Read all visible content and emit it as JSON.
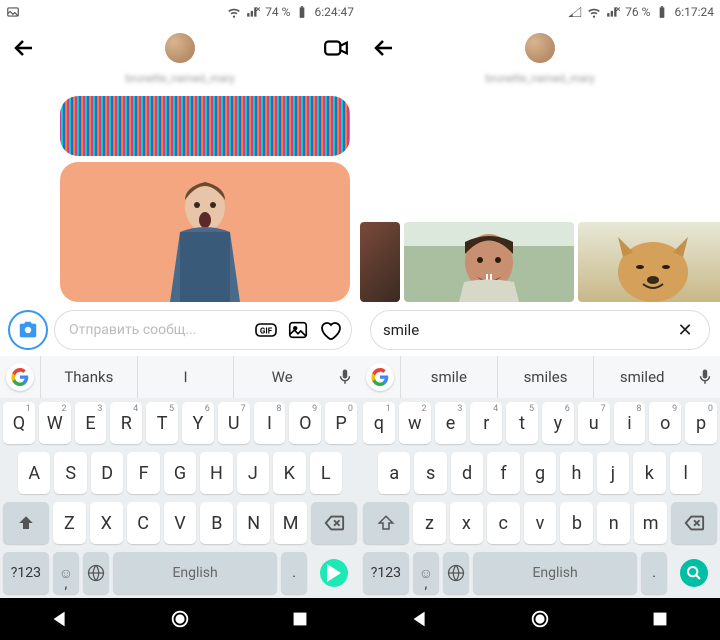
{
  "left": {
    "status": {
      "battery": "74 %",
      "time": "6:24:47"
    },
    "username": "brunette_named_mary",
    "composer": {
      "placeholder": "Отправить сообщ..."
    },
    "suggestions": [
      "Thanks",
      "I",
      "We"
    ],
    "keyboard": {
      "row1": [
        "Q",
        "W",
        "E",
        "R",
        "T",
        "Y",
        "U",
        "I",
        "O",
        "P"
      ],
      "sup1": [
        "1",
        "2",
        "3",
        "4",
        "5",
        "6",
        "7",
        "8",
        "9",
        "0"
      ],
      "row2": [
        "A",
        "S",
        "D",
        "F",
        "G",
        "H",
        "J",
        "K",
        "L"
      ],
      "row3": [
        "Z",
        "X",
        "C",
        "V",
        "B",
        "N",
        "M"
      ],
      "numkey": "?123",
      "space": "English"
    }
  },
  "right": {
    "status": {
      "battery": "76 %",
      "time": "6:17:24"
    },
    "username": "brunette_named_mary",
    "search": "smile",
    "suggestions": [
      "smile",
      "smiles",
      "smiled"
    ],
    "keyboard": {
      "row1": [
        "q",
        "w",
        "e",
        "r",
        "t",
        "y",
        "u",
        "i",
        "o",
        "p"
      ],
      "sup1": [
        "1",
        "2",
        "3",
        "4",
        "5",
        "6",
        "7",
        "8",
        "9",
        "0"
      ],
      "row2": [
        "a",
        "s",
        "d",
        "f",
        "g",
        "h",
        "j",
        "k",
        "l"
      ],
      "row3": [
        "z",
        "x",
        "c",
        "v",
        "b",
        "n",
        "m"
      ],
      "numkey": "?123",
      "space": "English"
    }
  }
}
